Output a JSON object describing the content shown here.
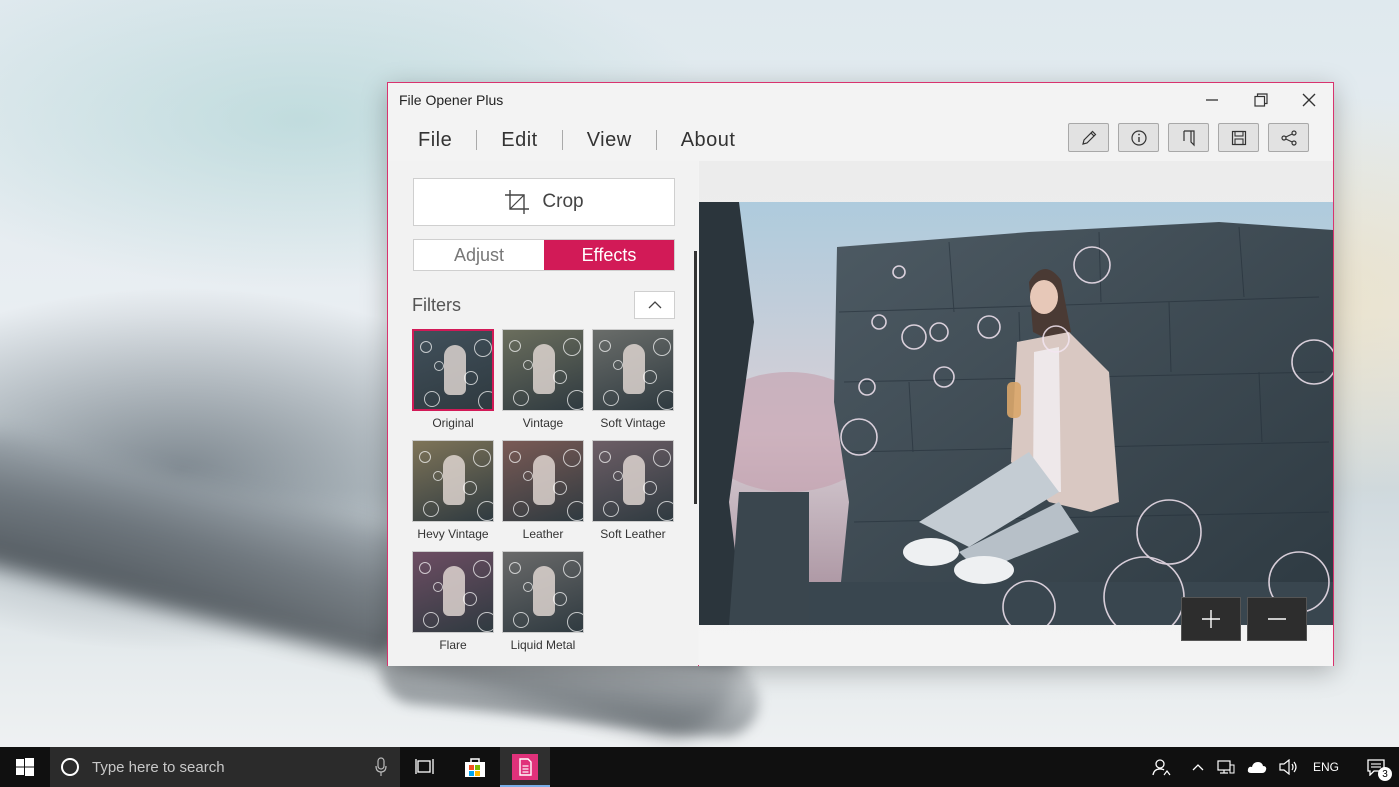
{
  "window": {
    "title": "File Opener Plus",
    "accent_color": "#d21a57",
    "controls": [
      "minimize-icon",
      "maximize-icon",
      "close-icon"
    ]
  },
  "menu": [
    "File",
    "Edit",
    "View",
    "About"
  ],
  "toolbar": {
    "buttons": [
      "pencil-icon",
      "info-icon",
      "bookmark-icon",
      "save-icon",
      "share-icon"
    ]
  },
  "left_panel": {
    "crop_label": "Crop",
    "tabs": {
      "adjust": "Adjust",
      "effects": "Effects",
      "selected": "Effects"
    },
    "filters_label": "Filters",
    "filters": [
      {
        "label": "Original",
        "selected": true,
        "tint": "#41505b"
      },
      {
        "label": "Vintage",
        "selected": false,
        "tint": "#6b6e5d"
      },
      {
        "label": "Soft Vintage",
        "selected": false,
        "tint": "#6a6d6a"
      },
      {
        "label": "Hevy Vintage",
        "selected": false,
        "tint": "#7e7458"
      },
      {
        "label": "Leather",
        "selected": false,
        "tint": "#7a5a55"
      },
      {
        "label": "Soft Leather",
        "selected": false,
        "tint": "#6d5e66"
      },
      {
        "label": "Flare",
        "selected": false,
        "tint": "#6d4d63"
      },
      {
        "label": "Liquid Metal",
        "selected": false,
        "tint": "#6a6a6a"
      }
    ]
  },
  "preview": {
    "zoom_in_icon": "plus-icon",
    "zoom_out_icon": "minus-icon"
  },
  "taskbar": {
    "search_placeholder": "Type here to search",
    "pinned": [
      "task-view-icon",
      "store-icon",
      "file-opener-app-icon"
    ],
    "language": "ENG",
    "notification_count": "3"
  }
}
